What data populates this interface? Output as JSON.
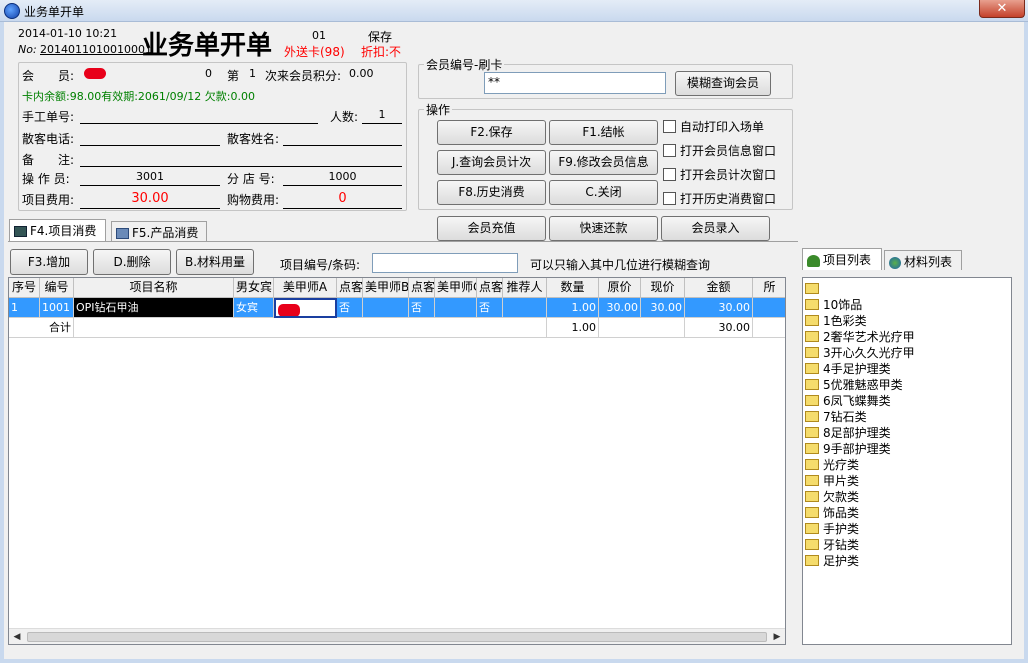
{
  "window": {
    "title": "业务单开单",
    "close_label": "✕"
  },
  "header": {
    "datetime": "2014-01-10 10:21",
    "code": "01",
    "save_status": "保存",
    "no_label": "No:",
    "order_no": "2014011010010001",
    "page_title": "业务单开单",
    "delivery": "外送卡(98)",
    "discount": "折扣:不"
  },
  "member_info": {
    "member_label": "会　　员:",
    "member_count": "0",
    "visit_label": "第",
    "visit_num": "1",
    "points_label": "次来会员积分:",
    "points_value": "0.00",
    "balance_line": "卡内余额:98.00有效期:2061/09/12 欠款:0.00",
    "manual_no_label": "手工单号:",
    "manual_no_value": "",
    "people_label": "人数:",
    "people_value": "1",
    "guest_phone_label": "散客电话:",
    "guest_phone_value": "",
    "guest_name_label": "散客姓名:",
    "guest_name_value": "",
    "note_label": "备　　注:",
    "note_value": "",
    "operator_label": "操 作 员:",
    "operator_value": "3001",
    "branch_label": "分 店 号:",
    "branch_value": "1000",
    "item_fee_label": "项目费用:",
    "item_fee_value": "30.00",
    "goods_fee_label": "购物费用:",
    "goods_fee_value": "0"
  },
  "swipe": {
    "group_label": "会员编号-刷卡",
    "card_value": "**",
    "fuzzy_button": "模糊查询会员"
  },
  "ops": {
    "group_label": "操作",
    "save": "F2.保存",
    "checkout": "F1.结帐",
    "query_count": "J.查询会员计次",
    "edit_member": "F9.修改会员信息",
    "history": "F8.历史消费",
    "close": "C.关闭",
    "auto_print": "自动打印入场单",
    "open_member_info": "打开会员信息窗口",
    "open_member_count": "打开会员计次窗口",
    "open_history": "打开历史消费窗口",
    "recharge": "会员充值",
    "repay": "快速还款",
    "member_entry": "会员录入"
  },
  "tabs": {
    "items": "F4.项目消费",
    "products": "F5.产品消费",
    "item_list": "项目列表",
    "material_list": "材料列表"
  },
  "toolbar": {
    "add": "F3.增加",
    "delete": "D.删除",
    "material": "B.材料用量",
    "barcode_label": "项目编号/条码:",
    "barcode_value": "",
    "hint": "可以只输入其中几位进行模糊查询"
  },
  "grid": {
    "columns": [
      "序号",
      "编号",
      "项目名称",
      "男女宾",
      "美甲师A",
      "点客",
      "美甲师B",
      "点客",
      "美甲师C",
      "点客",
      "推荐人",
      "数量",
      "原价",
      "现价",
      "金额",
      "所"
    ],
    "rows": [
      {
        "seq": "1",
        "code": "1001",
        "name": "OPI钻石甲油",
        "gender": "女宾",
        "techA": "",
        "pickA": "否",
        "techB": "",
        "pickB": "否",
        "techC": "",
        "pickC": "否",
        "ref": "",
        "qty": "1.00",
        "orig": "30.00",
        "price": "30.00",
        "amount": "30.00"
      }
    ],
    "total": {
      "label": "合计",
      "qty": "1.00",
      "amount": "30.00"
    }
  },
  "tree": {
    "items": [
      "",
      "10饰品",
      "1色彩类",
      "2奢华艺术光疗甲",
      "3开心久久光疗甲",
      "4手足护理类",
      "5优雅魅惑甲类",
      "6凤飞蝶舞类",
      "7钻石类",
      "8足部护理类",
      "9手部护理类",
      "光疗类",
      "甲片类",
      "欠款类",
      "饰品类",
      "手护类",
      "牙钻类",
      "足护类"
    ]
  },
  "colors": {
    "selection": "#3399ff",
    "red": "#ff0000",
    "green": "#008000"
  }
}
